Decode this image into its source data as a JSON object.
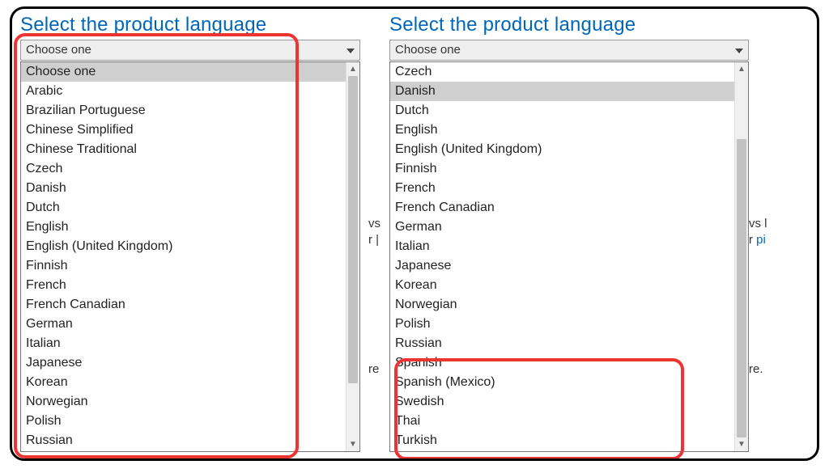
{
  "left": {
    "title": "Select the product language",
    "placeholder": "Choose one",
    "selected_index": 0,
    "options": [
      "Choose one",
      "Arabic",
      "Brazilian Portuguese",
      "Chinese Simplified",
      "Chinese Traditional",
      "Czech",
      "Danish",
      "Dutch",
      "English",
      "English (United Kingdom)",
      "Finnish",
      "French",
      "French Canadian",
      "German",
      "Italian",
      "Japanese",
      "Korean",
      "Norwegian",
      "Polish",
      "Russian"
    ]
  },
  "right": {
    "title": "Select the product language",
    "placeholder": "Choose one",
    "selected_index": 1,
    "options": [
      "Czech",
      "Danish",
      "Dutch",
      "English",
      "English (United Kingdom)",
      "Finnish",
      "French",
      "French Canadian",
      "German",
      "Italian",
      "Japanese",
      "Korean",
      "Norwegian",
      "Polish",
      "Russian",
      "Spanish",
      "Spanish (Mexico)",
      "Swedish",
      "Thai",
      "Turkish"
    ]
  },
  "bg": {
    "l1a": "vs l",
    "l1b": "r ",
    "l1c": "pi",
    "l2": "re.",
    "left_hint1": "vs",
    "left_hint2": "r |",
    "left_hint3": "re"
  }
}
